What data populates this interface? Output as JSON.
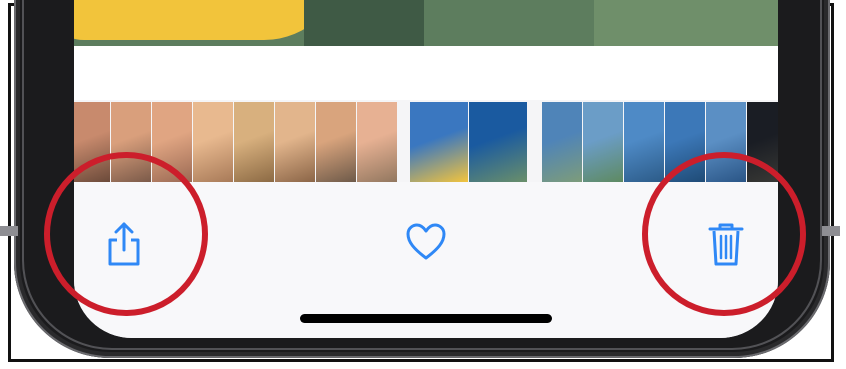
{
  "toolbar": {
    "accent": "#2f88f6",
    "buttons": [
      {
        "icon": "share-icon"
      },
      {
        "icon": "heart-icon"
      },
      {
        "icon": "trash-icon"
      }
    ]
  },
  "thumbnails": {
    "count": 17,
    "palettes": [
      [
        "#c88a6d",
        "#6b4a3a"
      ],
      [
        "#d99f7c",
        "#7b5a49"
      ],
      [
        "#e0a582",
        "#9b6a54"
      ],
      [
        "#e8b98f",
        "#a87a58"
      ],
      [
        "#d8b07e",
        "#8c6a44"
      ],
      [
        "#e2b58c",
        "#8b6547"
      ],
      [
        "#d9a47d",
        "#6e5a49"
      ],
      [
        "#e7b193",
        "#92775f"
      ],
      [
        "#3a77c0",
        "#f3c43d"
      ],
      [
        "#1a5aa0",
        "#6a8f6a"
      ],
      [
        "#4f84b8",
        "#7d9c7a"
      ],
      [
        "#6b9dc7",
        "#5e8a61"
      ],
      [
        "#4e8ac6",
        "#2c5b88"
      ],
      [
        "#3c78b8",
        "#1f4b76"
      ],
      [
        "#5b8fc4",
        "#2a5586"
      ],
      [
        "#1a1d24",
        "#3a3a36"
      ],
      [
        "#6f6a5e",
        "#2d2a24"
      ]
    ]
  },
  "annotations": {
    "color": "#cc1e2b",
    "highlighted": [
      "share-button",
      "delete-button"
    ]
  }
}
